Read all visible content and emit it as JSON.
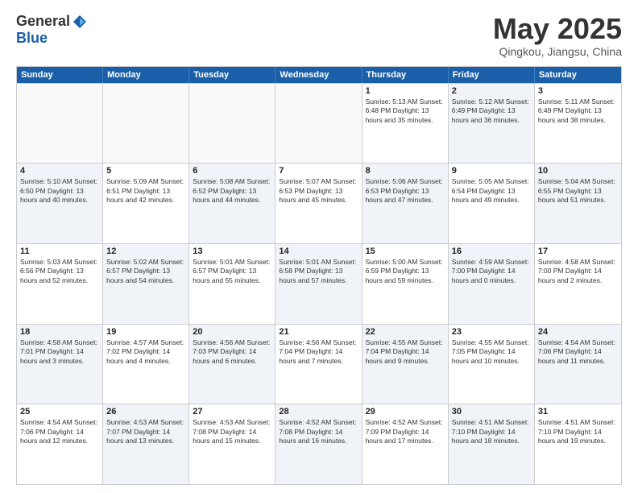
{
  "header": {
    "logo_general": "General",
    "logo_blue": "Blue",
    "month_title": "May 2025",
    "subtitle": "Qingkou, Jiangsu, China"
  },
  "weekdays": [
    "Sunday",
    "Monday",
    "Tuesday",
    "Wednesday",
    "Thursday",
    "Friday",
    "Saturday"
  ],
  "rows": [
    [
      {
        "day": "",
        "info": "",
        "empty": true
      },
      {
        "day": "",
        "info": "",
        "empty": true
      },
      {
        "day": "",
        "info": "",
        "empty": true
      },
      {
        "day": "",
        "info": "",
        "empty": true
      },
      {
        "day": "1",
        "info": "Sunrise: 5:13 AM\nSunset: 6:48 PM\nDaylight: 13 hours\nand 35 minutes."
      },
      {
        "day": "2",
        "info": "Sunrise: 5:12 AM\nSunset: 6:49 PM\nDaylight: 13 hours\nand 36 minutes.",
        "alt": true
      },
      {
        "day": "3",
        "info": "Sunrise: 5:11 AM\nSunset: 6:49 PM\nDaylight: 13 hours\nand 38 minutes."
      }
    ],
    [
      {
        "day": "4",
        "info": "Sunrise: 5:10 AM\nSunset: 6:50 PM\nDaylight: 13 hours\nand 40 minutes.",
        "alt": true
      },
      {
        "day": "5",
        "info": "Sunrise: 5:09 AM\nSunset: 6:51 PM\nDaylight: 13 hours\nand 42 minutes."
      },
      {
        "day": "6",
        "info": "Sunrise: 5:08 AM\nSunset: 6:52 PM\nDaylight: 13 hours\nand 44 minutes.",
        "alt": true
      },
      {
        "day": "7",
        "info": "Sunrise: 5:07 AM\nSunset: 6:53 PM\nDaylight: 13 hours\nand 45 minutes."
      },
      {
        "day": "8",
        "info": "Sunrise: 5:06 AM\nSunset: 6:53 PM\nDaylight: 13 hours\nand 47 minutes.",
        "alt": true
      },
      {
        "day": "9",
        "info": "Sunrise: 5:05 AM\nSunset: 6:54 PM\nDaylight: 13 hours\nand 49 minutes."
      },
      {
        "day": "10",
        "info": "Sunrise: 5:04 AM\nSunset: 6:55 PM\nDaylight: 13 hours\nand 51 minutes.",
        "alt": true
      }
    ],
    [
      {
        "day": "11",
        "info": "Sunrise: 5:03 AM\nSunset: 6:56 PM\nDaylight: 13 hours\nand 52 minutes."
      },
      {
        "day": "12",
        "info": "Sunrise: 5:02 AM\nSunset: 6:57 PM\nDaylight: 13 hours\nand 54 minutes.",
        "alt": true
      },
      {
        "day": "13",
        "info": "Sunrise: 5:01 AM\nSunset: 6:57 PM\nDaylight: 13 hours\nand 55 minutes."
      },
      {
        "day": "14",
        "info": "Sunrise: 5:01 AM\nSunset: 6:58 PM\nDaylight: 13 hours\nand 57 minutes.",
        "alt": true
      },
      {
        "day": "15",
        "info": "Sunrise: 5:00 AM\nSunset: 6:59 PM\nDaylight: 13 hours\nand 59 minutes."
      },
      {
        "day": "16",
        "info": "Sunrise: 4:59 AM\nSunset: 7:00 PM\nDaylight: 14 hours\nand 0 minutes.",
        "alt": true
      },
      {
        "day": "17",
        "info": "Sunrise: 4:58 AM\nSunset: 7:00 PM\nDaylight: 14 hours\nand 2 minutes."
      }
    ],
    [
      {
        "day": "18",
        "info": "Sunrise: 4:58 AM\nSunset: 7:01 PM\nDaylight: 14 hours\nand 3 minutes.",
        "alt": true
      },
      {
        "day": "19",
        "info": "Sunrise: 4:57 AM\nSunset: 7:02 PM\nDaylight: 14 hours\nand 4 minutes."
      },
      {
        "day": "20",
        "info": "Sunrise: 4:56 AM\nSunset: 7:03 PM\nDaylight: 14 hours\nand 6 minutes.",
        "alt": true
      },
      {
        "day": "21",
        "info": "Sunrise: 4:56 AM\nSunset: 7:04 PM\nDaylight: 14 hours\nand 7 minutes."
      },
      {
        "day": "22",
        "info": "Sunrise: 4:55 AM\nSunset: 7:04 PM\nDaylight: 14 hours\nand 9 minutes.",
        "alt": true
      },
      {
        "day": "23",
        "info": "Sunrise: 4:55 AM\nSunset: 7:05 PM\nDaylight: 14 hours\nand 10 minutes."
      },
      {
        "day": "24",
        "info": "Sunrise: 4:54 AM\nSunset: 7:06 PM\nDaylight: 14 hours\nand 11 minutes.",
        "alt": true
      }
    ],
    [
      {
        "day": "25",
        "info": "Sunrise: 4:54 AM\nSunset: 7:06 PM\nDaylight: 14 hours\nand 12 minutes."
      },
      {
        "day": "26",
        "info": "Sunrise: 4:53 AM\nSunset: 7:07 PM\nDaylight: 14 hours\nand 13 minutes.",
        "alt": true
      },
      {
        "day": "27",
        "info": "Sunrise: 4:53 AM\nSunset: 7:08 PM\nDaylight: 14 hours\nand 15 minutes."
      },
      {
        "day": "28",
        "info": "Sunrise: 4:52 AM\nSunset: 7:08 PM\nDaylight: 14 hours\nand 16 minutes.",
        "alt": true
      },
      {
        "day": "29",
        "info": "Sunrise: 4:52 AM\nSunset: 7:09 PM\nDaylight: 14 hours\nand 17 minutes."
      },
      {
        "day": "30",
        "info": "Sunrise: 4:51 AM\nSunset: 7:10 PM\nDaylight: 14 hours\nand 18 minutes.",
        "alt": true
      },
      {
        "day": "31",
        "info": "Sunrise: 4:51 AM\nSunset: 7:10 PM\nDaylight: 14 hours\nand 19 minutes."
      }
    ]
  ]
}
